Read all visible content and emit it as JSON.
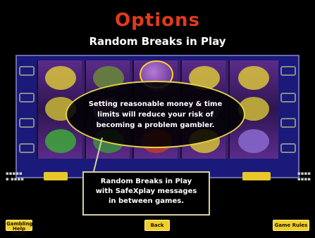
{
  "header": {
    "title": "Options",
    "subtitle": "Random Breaks in Play"
  },
  "overlay": {
    "message": "Setting reasonable money & time limits will reduce your risk of becoming a problem gambler."
  },
  "callout": {
    "line1": "Random Breaks in Play",
    "line2": "with SafeXplay messages",
    "line3": "in between games."
  },
  "buttons": {
    "left_line1": "Gambling",
    "left_line2": "Help Desk",
    "back": "Back",
    "right": "Game Rules"
  },
  "colors": {
    "title": "#e23a1a",
    "button": "#f0cf2a",
    "highlight": "#e6d24a"
  }
}
